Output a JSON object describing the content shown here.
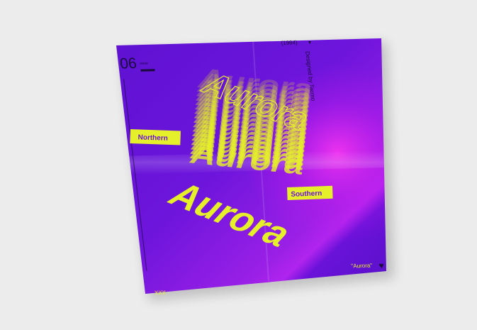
{
  "poster": {
    "issue_number": "06",
    "issue_suffix": "issue",
    "year": "(1994)",
    "designer_credit": "Designed by Tacmo",
    "outline_title": "Aurora",
    "main_title": "Aurora",
    "label_northern": "Northern",
    "label_southern": "Southern",
    "quote_title": "\"Aurora\"",
    "footer_code": "XXX",
    "colors": {
      "background": "#ececec",
      "poster_purple": "#6a12d9",
      "poster_magenta": "#d51bf0",
      "accent_yellow": "#e6f02a",
      "text_dark": "#1b0b3d"
    }
  }
}
